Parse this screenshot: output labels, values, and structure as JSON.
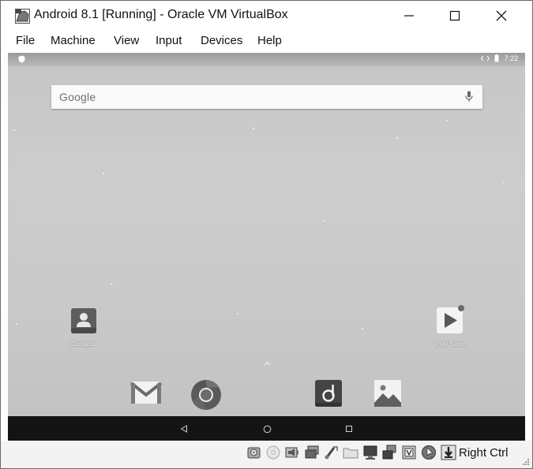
{
  "window": {
    "title": "Android 8.1 [Running] - Oracle VM VirtualBox",
    "controls": [
      "minimize-icon",
      "maximize-icon",
      "close-icon"
    ]
  },
  "menu": {
    "items": [
      "File",
      "Machine",
      "View",
      "Input",
      "Devices",
      "Help"
    ]
  },
  "android": {
    "status": {
      "time": "7:22",
      "icons": [
        "shield-icon",
        "data-arrows-icon",
        "battery-icon"
      ]
    },
    "search": {
      "logo_text": "Google",
      "icon": "mic-icon"
    },
    "home_apps": [
      {
        "label": "Contacts",
        "icon": "contacts-icon"
      },
      {
        "label": "Play Store",
        "icon": "play-store-icon"
      }
    ],
    "drawer_icon": "chevron-up-icon",
    "dock": [
      {
        "name": "gmail",
        "icon": "gmail-icon"
      },
      {
        "name": "chrome",
        "icon": "chrome-icon"
      },
      {
        "name": "music",
        "icon": "music-icon"
      },
      {
        "name": "photos",
        "icon": "photos-icon"
      }
    ],
    "nav": [
      "back-icon",
      "home-icon",
      "recents-icon"
    ]
  },
  "vbox_status": {
    "icons": [
      "hard-disk-icon",
      "optical-disk-icon",
      "audio-icon",
      "network-icon",
      "usb-icon",
      "shared-folders-icon",
      "display-icon",
      "video-capture-icon",
      "virtualization-icon",
      "mouse-integration-icon",
      "keyboard-capture-icon"
    ],
    "host_key": "Right Ctrl"
  }
}
